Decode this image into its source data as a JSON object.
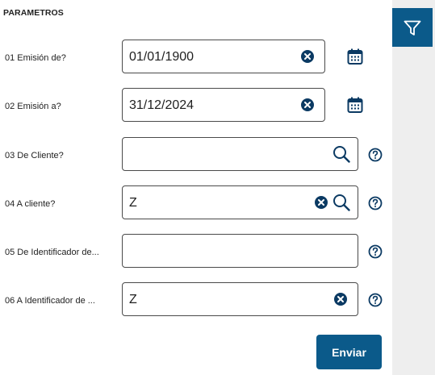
{
  "header": {
    "title": "PARAMETROS"
  },
  "params": [
    {
      "label": "01 Emisión de?",
      "value": "01/01/1900"
    },
    {
      "label": "02 Emisión a?",
      "value": "31/12/2024"
    },
    {
      "label": "03 De Cliente?",
      "value": ""
    },
    {
      "label": "04 A cliente?",
      "value": "Z"
    },
    {
      "label": "05 De Identificador de...",
      "value": ""
    },
    {
      "label": "06 A Identificador de ...",
      "value": "Z"
    }
  ],
  "actions": {
    "submit_label": "Enviar"
  },
  "icons": {
    "filter": "filter-icon",
    "clear": "clear-icon",
    "search": "search-icon",
    "calendar": "calendar-icon",
    "help": "help-icon"
  },
  "colors": {
    "primary": "#0b5a8a",
    "icon": "#0b3a63",
    "sidebar": "#eeeeee"
  }
}
